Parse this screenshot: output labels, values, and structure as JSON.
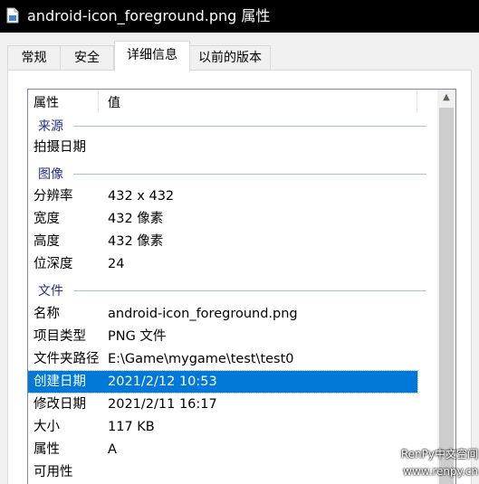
{
  "window": {
    "title": "android-icon_foreground.png 属性"
  },
  "tabs": [
    {
      "label": "常规"
    },
    {
      "label": "安全"
    },
    {
      "label": "详细信息"
    },
    {
      "label": "以前的版本"
    }
  ],
  "columns": {
    "name": "属性",
    "value": "值"
  },
  "groups": {
    "source": "来源",
    "image": "图像",
    "file": "文件"
  },
  "rows": {
    "date_taken": {
      "key": "拍摄日期",
      "value": ""
    },
    "resolution": {
      "key": "分辨率",
      "value": "432 x 432"
    },
    "width": {
      "key": "宽度",
      "value": "432 像素"
    },
    "height": {
      "key": "高度",
      "value": "432 像素"
    },
    "bit_depth": {
      "key": "位深度",
      "value": "24"
    },
    "name": {
      "key": "名称",
      "value": "android-icon_foreground.png"
    },
    "item_type": {
      "key": "项目类型",
      "value": "PNG 文件"
    },
    "folder_path": {
      "key": "文件夹路径",
      "value": "E:\\Game\\mygame\\test\\test0"
    },
    "created": {
      "key": "创建日期",
      "value": "2021/2/12 10:53"
    },
    "modified": {
      "key": "修改日期",
      "value": "2021/2/11 16:17"
    },
    "size": {
      "key": "大小",
      "value": "117 KB"
    },
    "attributes": {
      "key": "属性",
      "value": "A"
    },
    "availability": {
      "key": "可用性",
      "value": ""
    }
  },
  "watermark": {
    "line1": "RenPy中文空间",
    "line2": "www.renpy.cn"
  },
  "colors": {
    "selection": "#0078d7",
    "group_text": "#1e3287",
    "title_bg": "#000000"
  },
  "icons": {
    "title": "file-icon",
    "scroll_up": "chevron-up-icon"
  }
}
